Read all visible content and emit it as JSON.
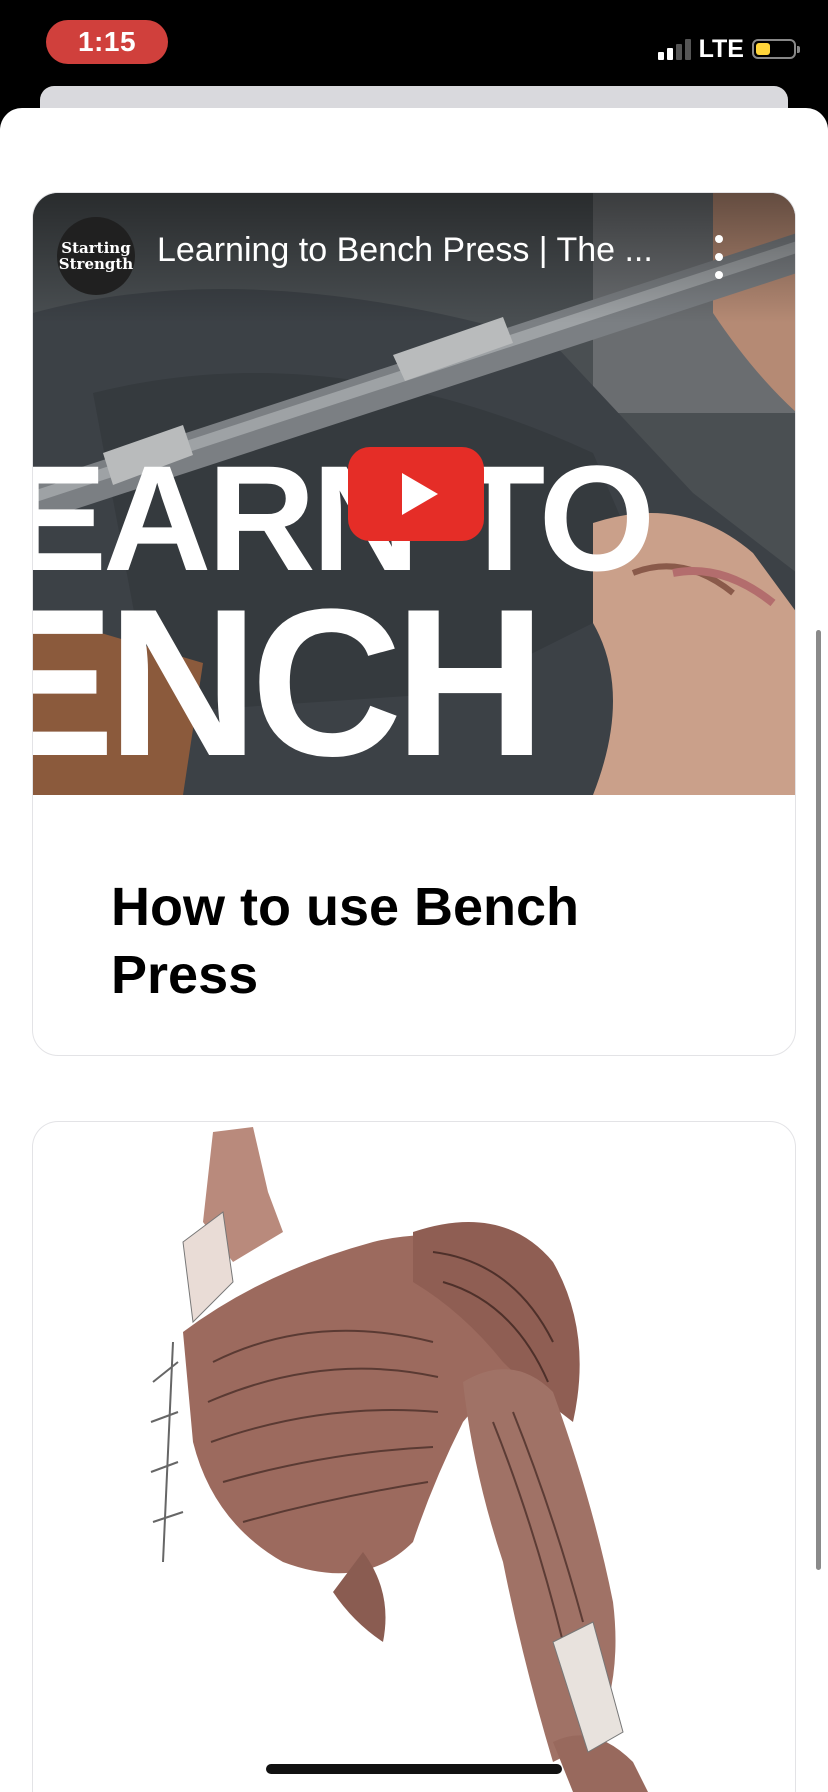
{
  "status_bar": {
    "time": "1:15",
    "network": "LTE",
    "battery_level_fraction": 0.4,
    "time_pill_color": "#d0403c",
    "battery_color": "#ffd53a"
  },
  "video_card": {
    "channel_name": "Starting Strength",
    "video_title": "Learning to Bench Press | The ...",
    "thumbnail_line_1": "EARN TO",
    "thumbnail_line_2": "ENCH",
    "play_button_color": "#e52d27",
    "title": "How to use Bench Press"
  },
  "image_card": {
    "image_subject": "pectoral and deltoid muscle anatomy illustration"
  },
  "icons": {
    "play": "play-icon",
    "more": "more-vertical-icon",
    "signal": "cellular-signal-icon",
    "battery": "battery-icon"
  }
}
